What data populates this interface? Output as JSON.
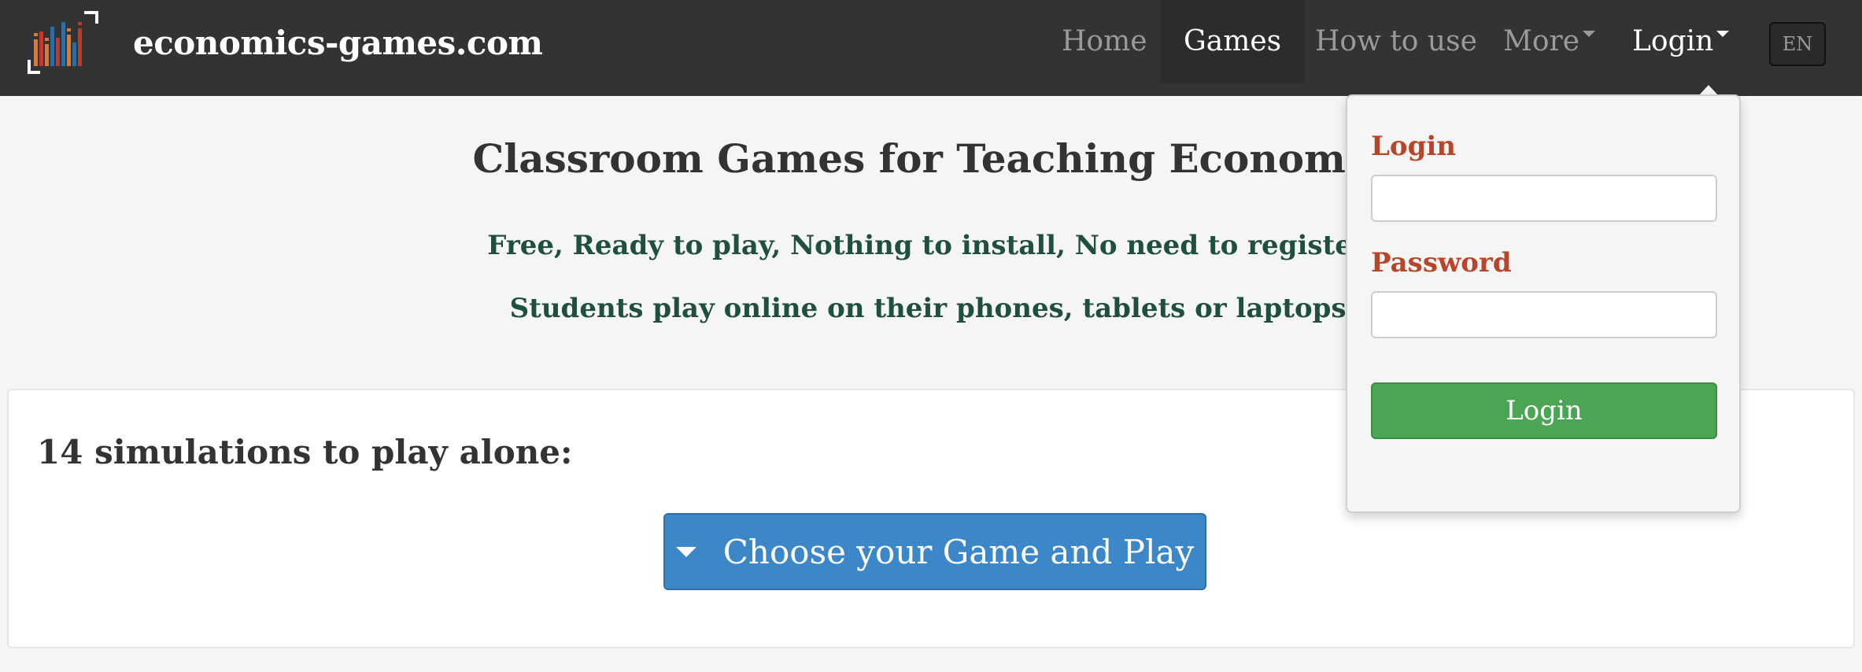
{
  "brand": {
    "name": "economics-games.com",
    "logo_icon": "bar-chart-logo-icon"
  },
  "nav": {
    "home": "Home",
    "games": "Games",
    "how_to_use": "How to use",
    "more": "More",
    "login": "Login",
    "language": "EN"
  },
  "hero": {
    "title": "Classroom Games for Teaching Economics",
    "subtitle_1": "Free, Ready to play, Nothing to install, No need to register!",
    "subtitle_2": "Students play online on their phones, tablets or laptops."
  },
  "panel": {
    "heading": "14 simulations to play alone:",
    "choose_button": "Choose your Game and Play"
  },
  "login_dropdown": {
    "login_label": "Login",
    "login_value": "",
    "password_label": "Password",
    "password_value": "",
    "submit_label": "Login"
  },
  "colors": {
    "navbar": "#333333",
    "page_bg": "#f5f5f5",
    "subtitle": "#1f4f3f",
    "label": "#b8452a",
    "primary_button": "#3c87c8",
    "success_button": "#4aa653"
  }
}
